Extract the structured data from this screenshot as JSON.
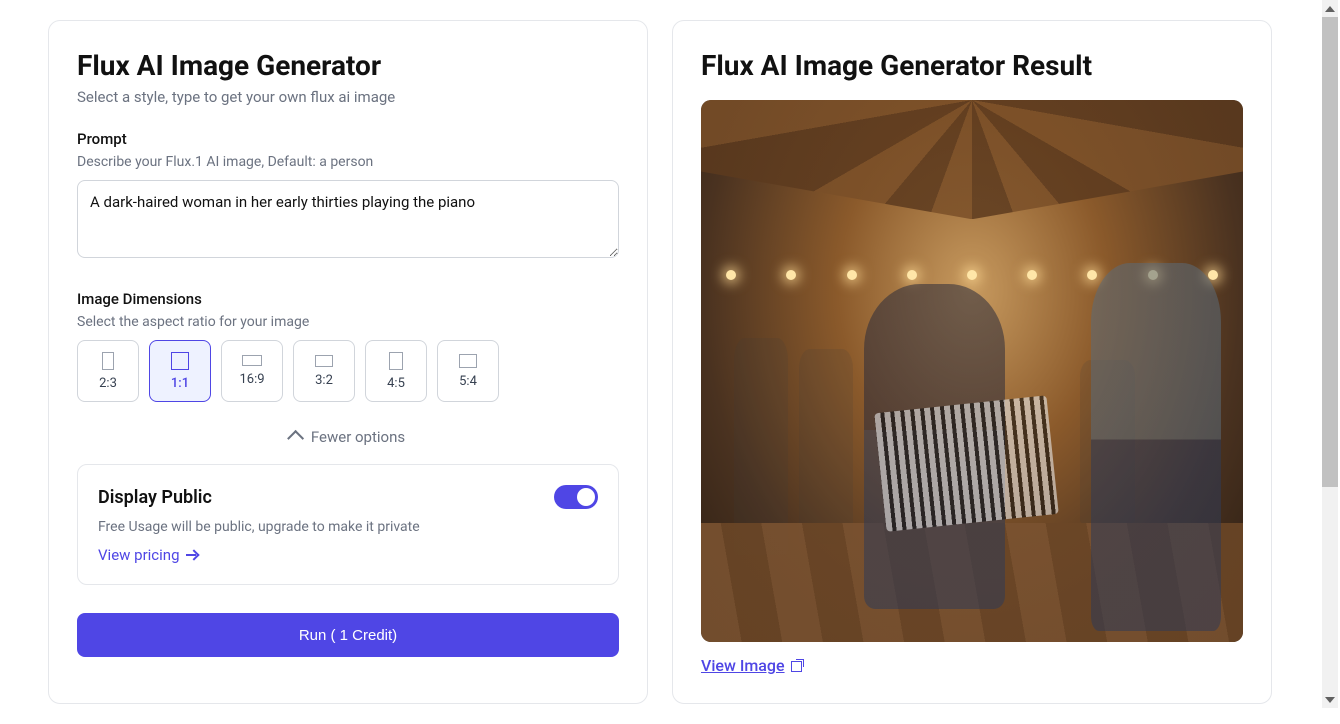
{
  "generator": {
    "title": "Flux AI Image Generator",
    "subtitle": "Select a style, type to get your own flux ai image",
    "prompt_label": "Prompt",
    "prompt_help": "Describe your Flux.1 AI image, Default: a person",
    "prompt_value": "A dark-haired woman in her early thirties playing the piano",
    "dimensions_label": "Image Dimensions",
    "dimensions_help": "Select the aspect ratio for your image",
    "ratios": [
      {
        "label": "2:3",
        "w": 12,
        "h": 18
      },
      {
        "label": "1:1",
        "w": 18,
        "h": 18
      },
      {
        "label": "16:9",
        "w": 20,
        "h": 11
      },
      {
        "label": "3:2",
        "w": 18,
        "h": 12
      },
      {
        "label": "4:5",
        "w": 14,
        "h": 18
      },
      {
        "label": "5:4",
        "w": 18,
        "h": 14
      }
    ],
    "selected_ratio": "1:1",
    "fewer_options": "Fewer options",
    "public": {
      "title": "Display Public",
      "desc": "Free Usage will be public, upgrade to make it private",
      "pricing_link": "View pricing",
      "enabled": true
    },
    "run_label": "Run   ( 1 Credit)"
  },
  "result": {
    "title": "Flux AI Image Generator Result",
    "view_image": "View Image"
  }
}
